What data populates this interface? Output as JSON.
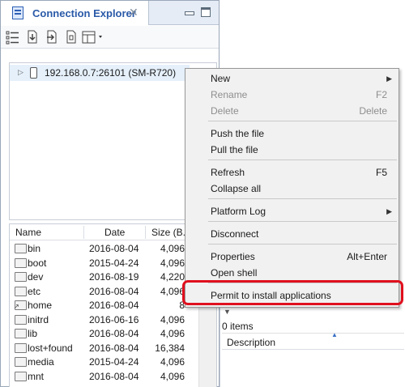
{
  "tab": {
    "title": "Connection Explorer",
    "icon": "connection-explorer-icon"
  },
  "toolbar": {
    "buttons": [
      "list-view-icon",
      "pull-file-icon",
      "push-file-icon",
      "copy-file-icon",
      "layout-menu-icon"
    ]
  },
  "tree": {
    "device": "192.168.0.7:26101 (SM-R720)"
  },
  "files": {
    "columns": {
      "name": "Name",
      "date": "Date",
      "size": "Size (B..."
    },
    "rows": [
      {
        "name": "bin",
        "date": "2016-08-04",
        "size": "4,096",
        "link": false
      },
      {
        "name": "boot",
        "date": "2015-04-24",
        "size": "4,096",
        "link": false
      },
      {
        "name": "dev",
        "date": "2016-08-19",
        "size": "4,220",
        "link": false
      },
      {
        "name": "etc",
        "date": "2016-08-04",
        "size": "4,096",
        "link": false
      },
      {
        "name": "home",
        "date": "2016-08-04",
        "size": "8",
        "link": true
      },
      {
        "name": "initrd",
        "date": "2016-06-16",
        "size": "4,096",
        "link": false
      },
      {
        "name": "lib",
        "date": "2016-08-04",
        "size": "4,096",
        "link": false
      },
      {
        "name": "lost+found",
        "date": "2016-08-04",
        "size": "16,384",
        "link": false
      },
      {
        "name": "media",
        "date": "2015-04-24",
        "size": "4,096",
        "link": false
      },
      {
        "name": "mnt",
        "date": "2016-08-04",
        "size": "4,096",
        "link": false
      }
    ]
  },
  "details": {
    "items_count": "0 items",
    "column": "Description"
  },
  "context_menu": {
    "items": [
      {
        "label": "New",
        "shortcut": "",
        "submenu": true,
        "enabled": true
      },
      {
        "label": "Rename",
        "shortcut": "F2",
        "submenu": false,
        "enabled": false
      },
      {
        "label": "Delete",
        "shortcut": "Delete",
        "submenu": false,
        "enabled": false
      },
      {
        "label": "Push the file",
        "shortcut": "",
        "submenu": false,
        "enabled": true
      },
      {
        "label": "Pull the file",
        "shortcut": "",
        "submenu": false,
        "enabled": true
      },
      {
        "label": "Refresh",
        "shortcut": "F5",
        "submenu": false,
        "enabled": true
      },
      {
        "label": "Collapse all",
        "shortcut": "",
        "submenu": false,
        "enabled": true
      },
      {
        "label": "Platform Log",
        "shortcut": "",
        "submenu": true,
        "enabled": true
      },
      {
        "label": "Disconnect",
        "shortcut": "",
        "submenu": false,
        "enabled": true
      },
      {
        "label": "Properties",
        "shortcut": "Alt+Enter",
        "submenu": false,
        "enabled": true
      },
      {
        "label": "Open shell",
        "shortcut": "",
        "submenu": false,
        "enabled": true
      },
      {
        "label": "Permit to install applications",
        "shortcut": "",
        "submenu": false,
        "enabled": true
      }
    ]
  },
  "colors": {
    "highlight": "#e0101e",
    "tab_title": "#2a5aa8",
    "selection": "#e5f0fb"
  }
}
